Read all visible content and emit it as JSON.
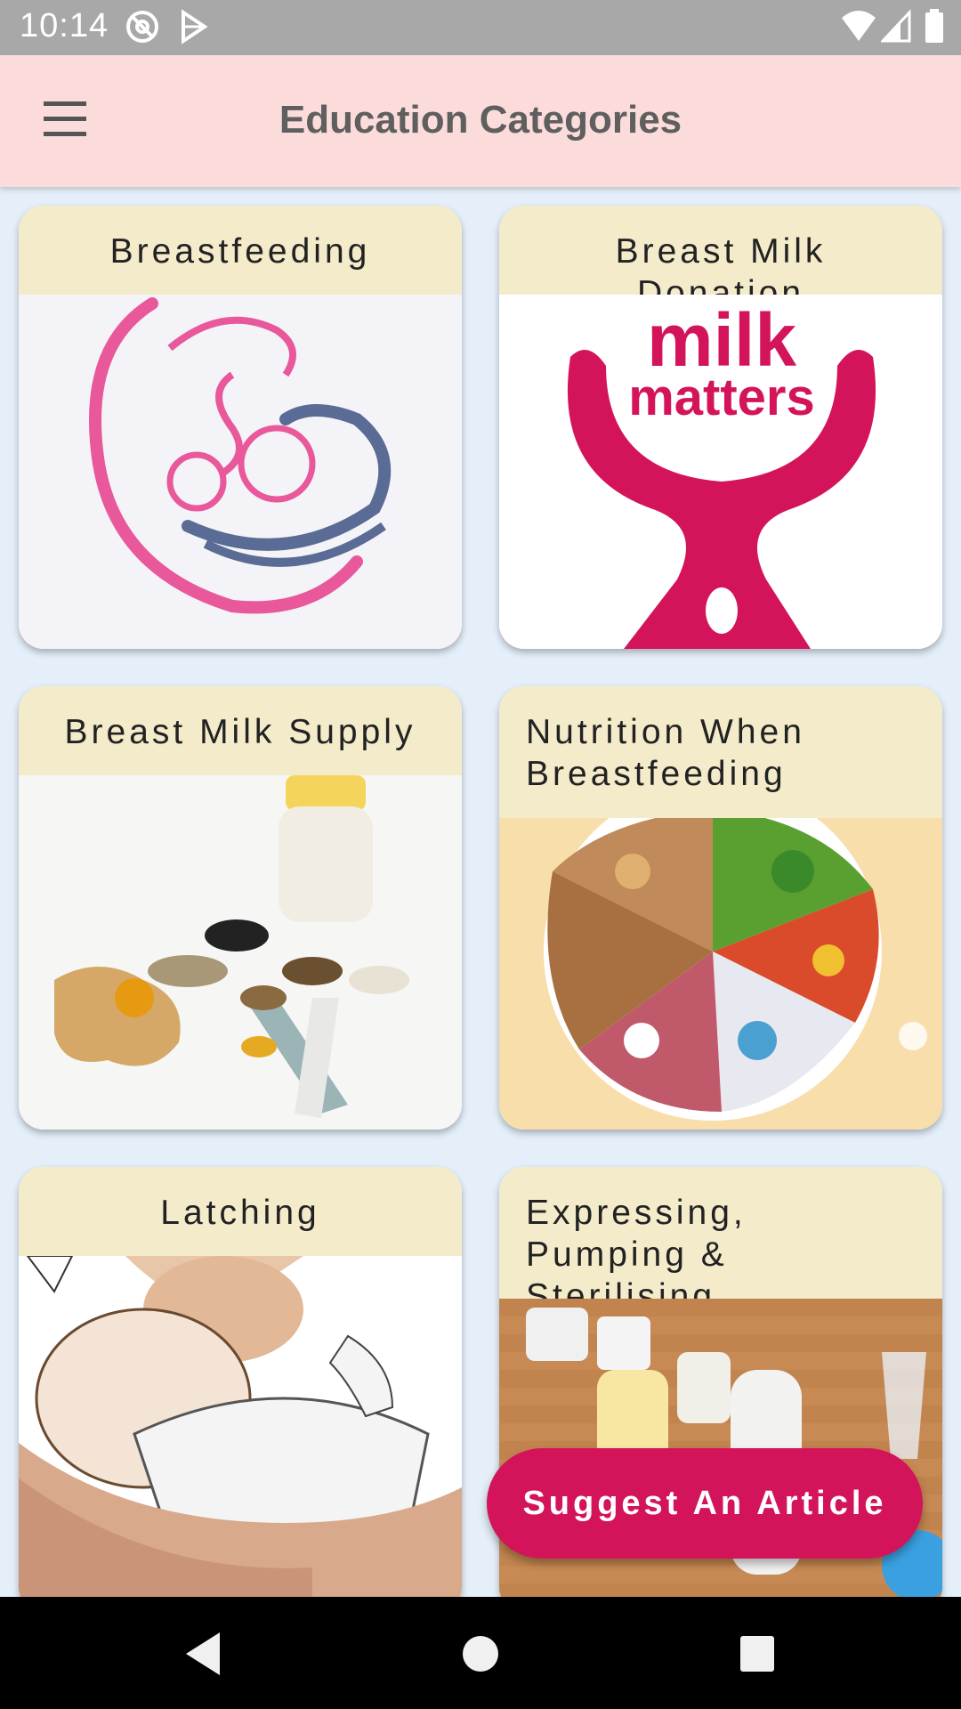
{
  "status_bar": {
    "time": "10:14",
    "icons": [
      "at-sign-icon",
      "play-store-icon",
      "wifi-icon",
      "signal-icon",
      "battery-icon"
    ]
  },
  "app_bar": {
    "menu_icon": "hamburger-menu-icon",
    "title": "Education Categories"
  },
  "categories": [
    {
      "title": "Breastfeeding",
      "image": "mother-baby-illustration"
    },
    {
      "title": "Breast Milk Donation",
      "image": "milk-matters-logo",
      "logo_line1": "milk",
      "logo_line2": "matters"
    },
    {
      "title": "Breast Milk Supply",
      "image": "ginger-seeds-bottle-photo"
    },
    {
      "title": "Nutrition When Breastfeeding",
      "image": "food-plate-photo"
    },
    {
      "title": "Latching",
      "image": "baby-latching-illustration"
    },
    {
      "title": "Expressing, Pumping & Sterilising",
      "image": "bottles-pumps-photo"
    }
  ],
  "fab": {
    "label": "Suggest An Article"
  },
  "nav_bar": {
    "icons": [
      "back-icon",
      "home-icon",
      "recents-icon"
    ]
  },
  "colors": {
    "app_bar_bg": "#fbdcdb",
    "page_bg": "#e4effa",
    "card_header_bg": "#f4ebcb",
    "accent": "#d4145a"
  }
}
